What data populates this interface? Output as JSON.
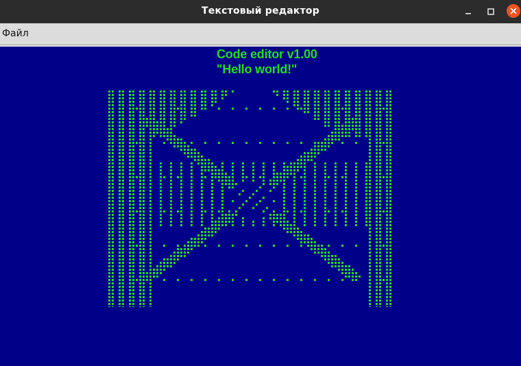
{
  "window": {
    "title": "Текстовый редактор",
    "controls": [
      "minimize-icon",
      "maximize-icon",
      "close-icon"
    ]
  },
  "menu": {
    "items": [
      "Файл"
    ]
  },
  "content": {
    "line1": "Code editor v1.00",
    "line2": "\"Hello world!\"",
    "art_description_icon": "green-dot-matrix-art"
  },
  "colors": {
    "background": "#000088",
    "text": "#22dd22",
    "dots": "#22dd22",
    "titlebar": "#2c2c2c",
    "menubar": "#dcdcdc",
    "close_button": "#e95420"
  }
}
